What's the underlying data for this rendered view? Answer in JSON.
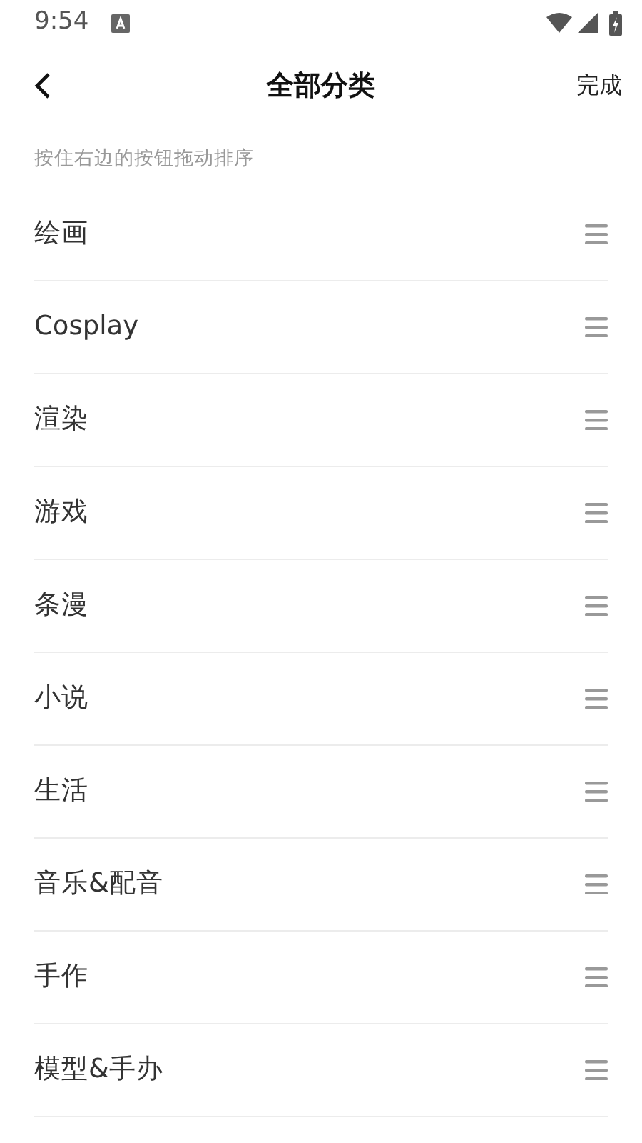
{
  "status_bar": {
    "time": "9:54"
  },
  "header": {
    "title": "全部分类",
    "done": "完成"
  },
  "hint": "按住右边的按钮拖动排序",
  "categories": [
    {
      "label": "绘画"
    },
    {
      "label": "Cosplay"
    },
    {
      "label": "渲染"
    },
    {
      "label": "游戏"
    },
    {
      "label": "条漫"
    },
    {
      "label": "小说"
    },
    {
      "label": "生活"
    },
    {
      "label": "音乐&配音"
    },
    {
      "label": "手作"
    },
    {
      "label": "模型&手办"
    }
  ]
}
